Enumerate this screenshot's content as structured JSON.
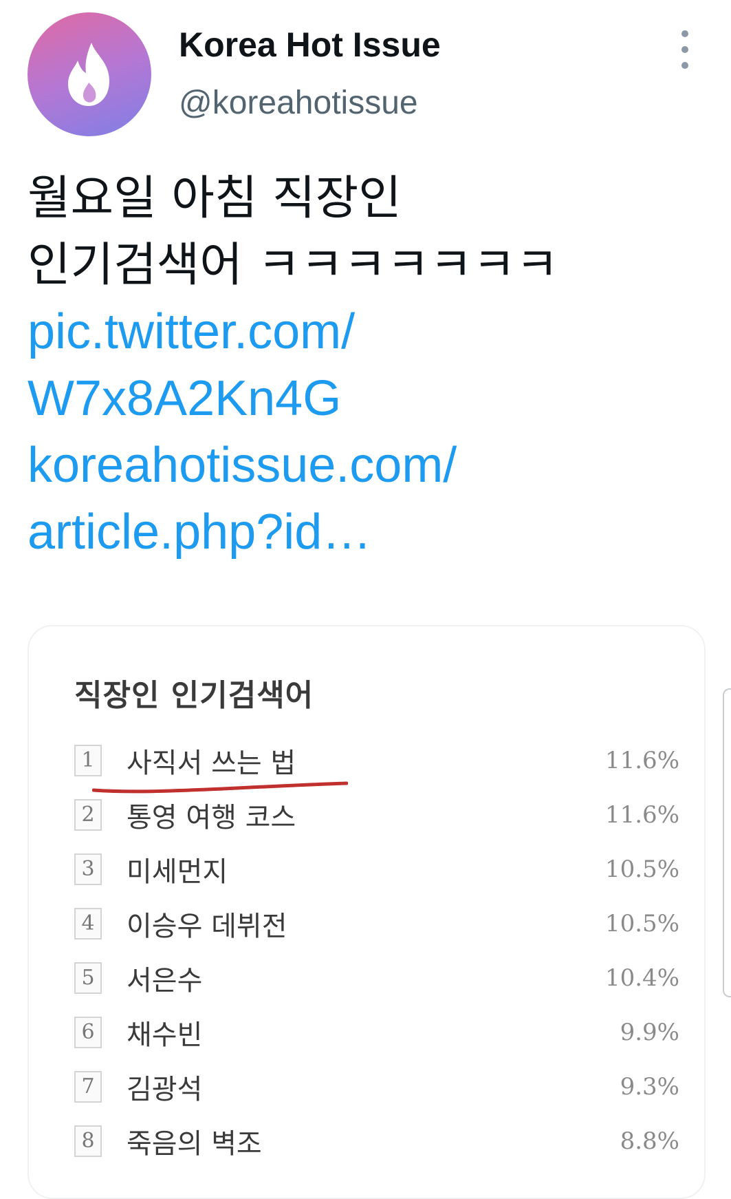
{
  "author": {
    "name": "Korea Hot Issue",
    "handle": "@koreahotissue",
    "avatar_icon": "flame-icon",
    "avatar_colors": [
      "#e06aa3",
      "#7f7fe6"
    ]
  },
  "tweet": {
    "lines": [
      "월요일 아침 직장인",
      "인기검색어 ㅋㅋㅋㅋㅋㅋㅋ"
    ],
    "links": [
      "pic.twitter.com/",
      "W7x8A2Kn4G",
      "koreahotissue.com/",
      "article.php?id…"
    ],
    "link_color": "#1d9bf0"
  },
  "card": {
    "title": "직장인 인기검색어",
    "rows": [
      {
        "rank": "1",
        "term": "사직서 쓰는 법",
        "pct": "11.6%"
      },
      {
        "rank": "2",
        "term": "통영 여행 코스",
        "pct": "11.6%"
      },
      {
        "rank": "3",
        "term": "미세먼지",
        "pct": "10.5%"
      },
      {
        "rank": "4",
        "term": "이승우 데뷔전",
        "pct": "10.5%"
      },
      {
        "rank": "5",
        "term": "서은수",
        "pct": "10.4%"
      },
      {
        "rank": "6",
        "term": "채수빈",
        "pct": "9.9%"
      },
      {
        "rank": "7",
        "term": "김광석",
        "pct": "9.3%"
      },
      {
        "rank": "8",
        "term": "죽음의 벽조",
        "pct": "8.8%"
      }
    ],
    "highlight_color": "#c0302e"
  }
}
